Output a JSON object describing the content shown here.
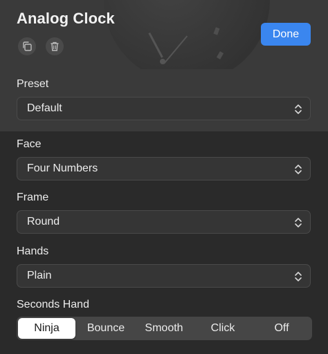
{
  "header": {
    "title": "Analog Clock",
    "done_label": "Done",
    "icons": [
      "duplicate-icon",
      "trash-icon"
    ]
  },
  "fields": {
    "preset": {
      "label": "Preset",
      "value": "Default"
    },
    "face": {
      "label": "Face",
      "value": "Four Numbers"
    },
    "frame": {
      "label": "Frame",
      "value": "Round"
    },
    "hands": {
      "label": "Hands",
      "value": "Plain"
    }
  },
  "seconds_hand": {
    "label": "Seconds Hand",
    "options": [
      "Ninja",
      "Bounce",
      "Smooth",
      "Click",
      "Off"
    ],
    "selected": "Ninja"
  },
  "colors": {
    "accent": "#3a86ef",
    "background": "#2a2a2a",
    "header_background": "#3a3a3a"
  }
}
